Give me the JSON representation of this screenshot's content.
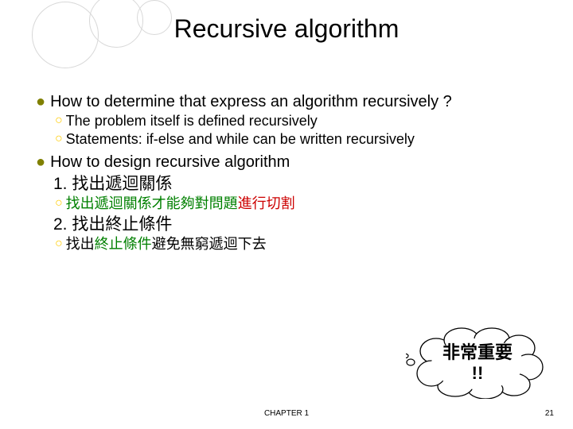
{
  "title": "Recursive algorithm",
  "points": {
    "p1": "How to determine that express an algorithm recursively ?",
    "p1a": "The problem itself is defined recursively",
    "p1b": "Statements: if-else and while can be written recursively",
    "p2": "How to design recursive algorithm",
    "num1": "1. 找出遞迴關係",
    "p2a_prefix": "找出遞迴關係才能夠對問題",
    "p2a_suffix": "進行切割",
    "num2": "2. 找出終止條件",
    "p2b_pre": "找出",
    "p2b_mid": "終止條件",
    "p2b_post": "避免無窮遞迴下去"
  },
  "cloud_line1": "非常重要",
  "cloud_line2": "!!",
  "footer": {
    "chapter": "CHAPTER 1",
    "page": "21"
  }
}
